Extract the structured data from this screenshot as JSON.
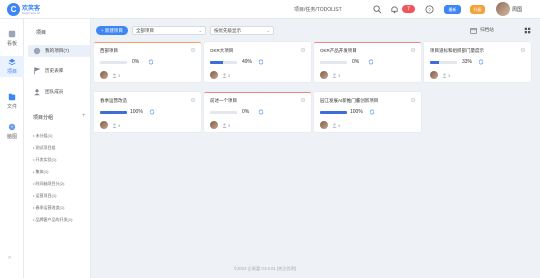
{
  "app": {
    "logo_letter": "C",
    "name": "欢笑客",
    "subtitle": "Happiness kit",
    "breadcrumb": "项目/任务/TODOLIST"
  },
  "header": {
    "notif_count": "7",
    "pill1": "最新",
    "pill2": "升级",
    "user_name": "周国"
  },
  "rail": [
    {
      "label": "看板",
      "icon": "board-icon"
    },
    {
      "label": "项目",
      "icon": "layers-icon"
    },
    {
      "label": "文件",
      "icon": "file-icon"
    },
    {
      "label": "脑图",
      "icon": "mindmap-icon"
    }
  ],
  "panel": {
    "title": "项目",
    "nav": [
      {
        "label": "我的项目(7)",
        "icon": "cube-icon"
      },
      {
        "label": "历史表库",
        "icon": "flag-icon"
      },
      {
        "label": "团队成员",
        "icon": "team-icon"
      }
    ],
    "section_title": "项目分组",
    "groups": [
      "• 未分组(1)",
      "• 测试项目组",
      "• 开发实验(1)",
      "• 集体(1)",
      "• 时间轴项目分(2)",
      "• 运营项目(1)",
      "• 春季运营改造(1)",
      "• 品牌客户品的开发(1)"
    ]
  },
  "toolbar": {
    "new_button": "+ 新建项目",
    "filter_value": "全部项目",
    "sort_value": "按优先级显示",
    "archive_label": "归档站"
  },
  "cards": [
    {
      "title": "西部项目",
      "progress": 0,
      "pct": "0%",
      "members": "3",
      "accent": "orange"
    },
    {
      "title": "OKR大项目",
      "progress": 49,
      "pct": "49%",
      "members": "3",
      "accent": "none"
    },
    {
      "title": "OKR产品开发项目",
      "progress": 0,
      "pct": "0%",
      "members": "3",
      "accent": "red"
    },
    {
      "title": "项目道标和组织部门量度示",
      "progress": 33,
      "pct": "33%",
      "members": "3",
      "accent": "none"
    },
    {
      "title": "春季运营改造",
      "progress": 100,
      "pct": "100%",
      "members": "3",
      "accent": "none"
    },
    {
      "title": "前述一个项目",
      "progress": 0,
      "pct": "0%",
      "members": "3",
      "accent": "red"
    },
    {
      "title": "园江发展AI新推门董创新项目",
      "progress": 100,
      "pct": "100%",
      "members": "4",
      "accent": "none"
    }
  ],
  "footer": "©2023 企易富 V3.0.01  [关注优明]",
  "colors": {
    "accent": "#3d86f6",
    "danger": "#f0545c",
    "progress": "#3d6dd8"
  }
}
